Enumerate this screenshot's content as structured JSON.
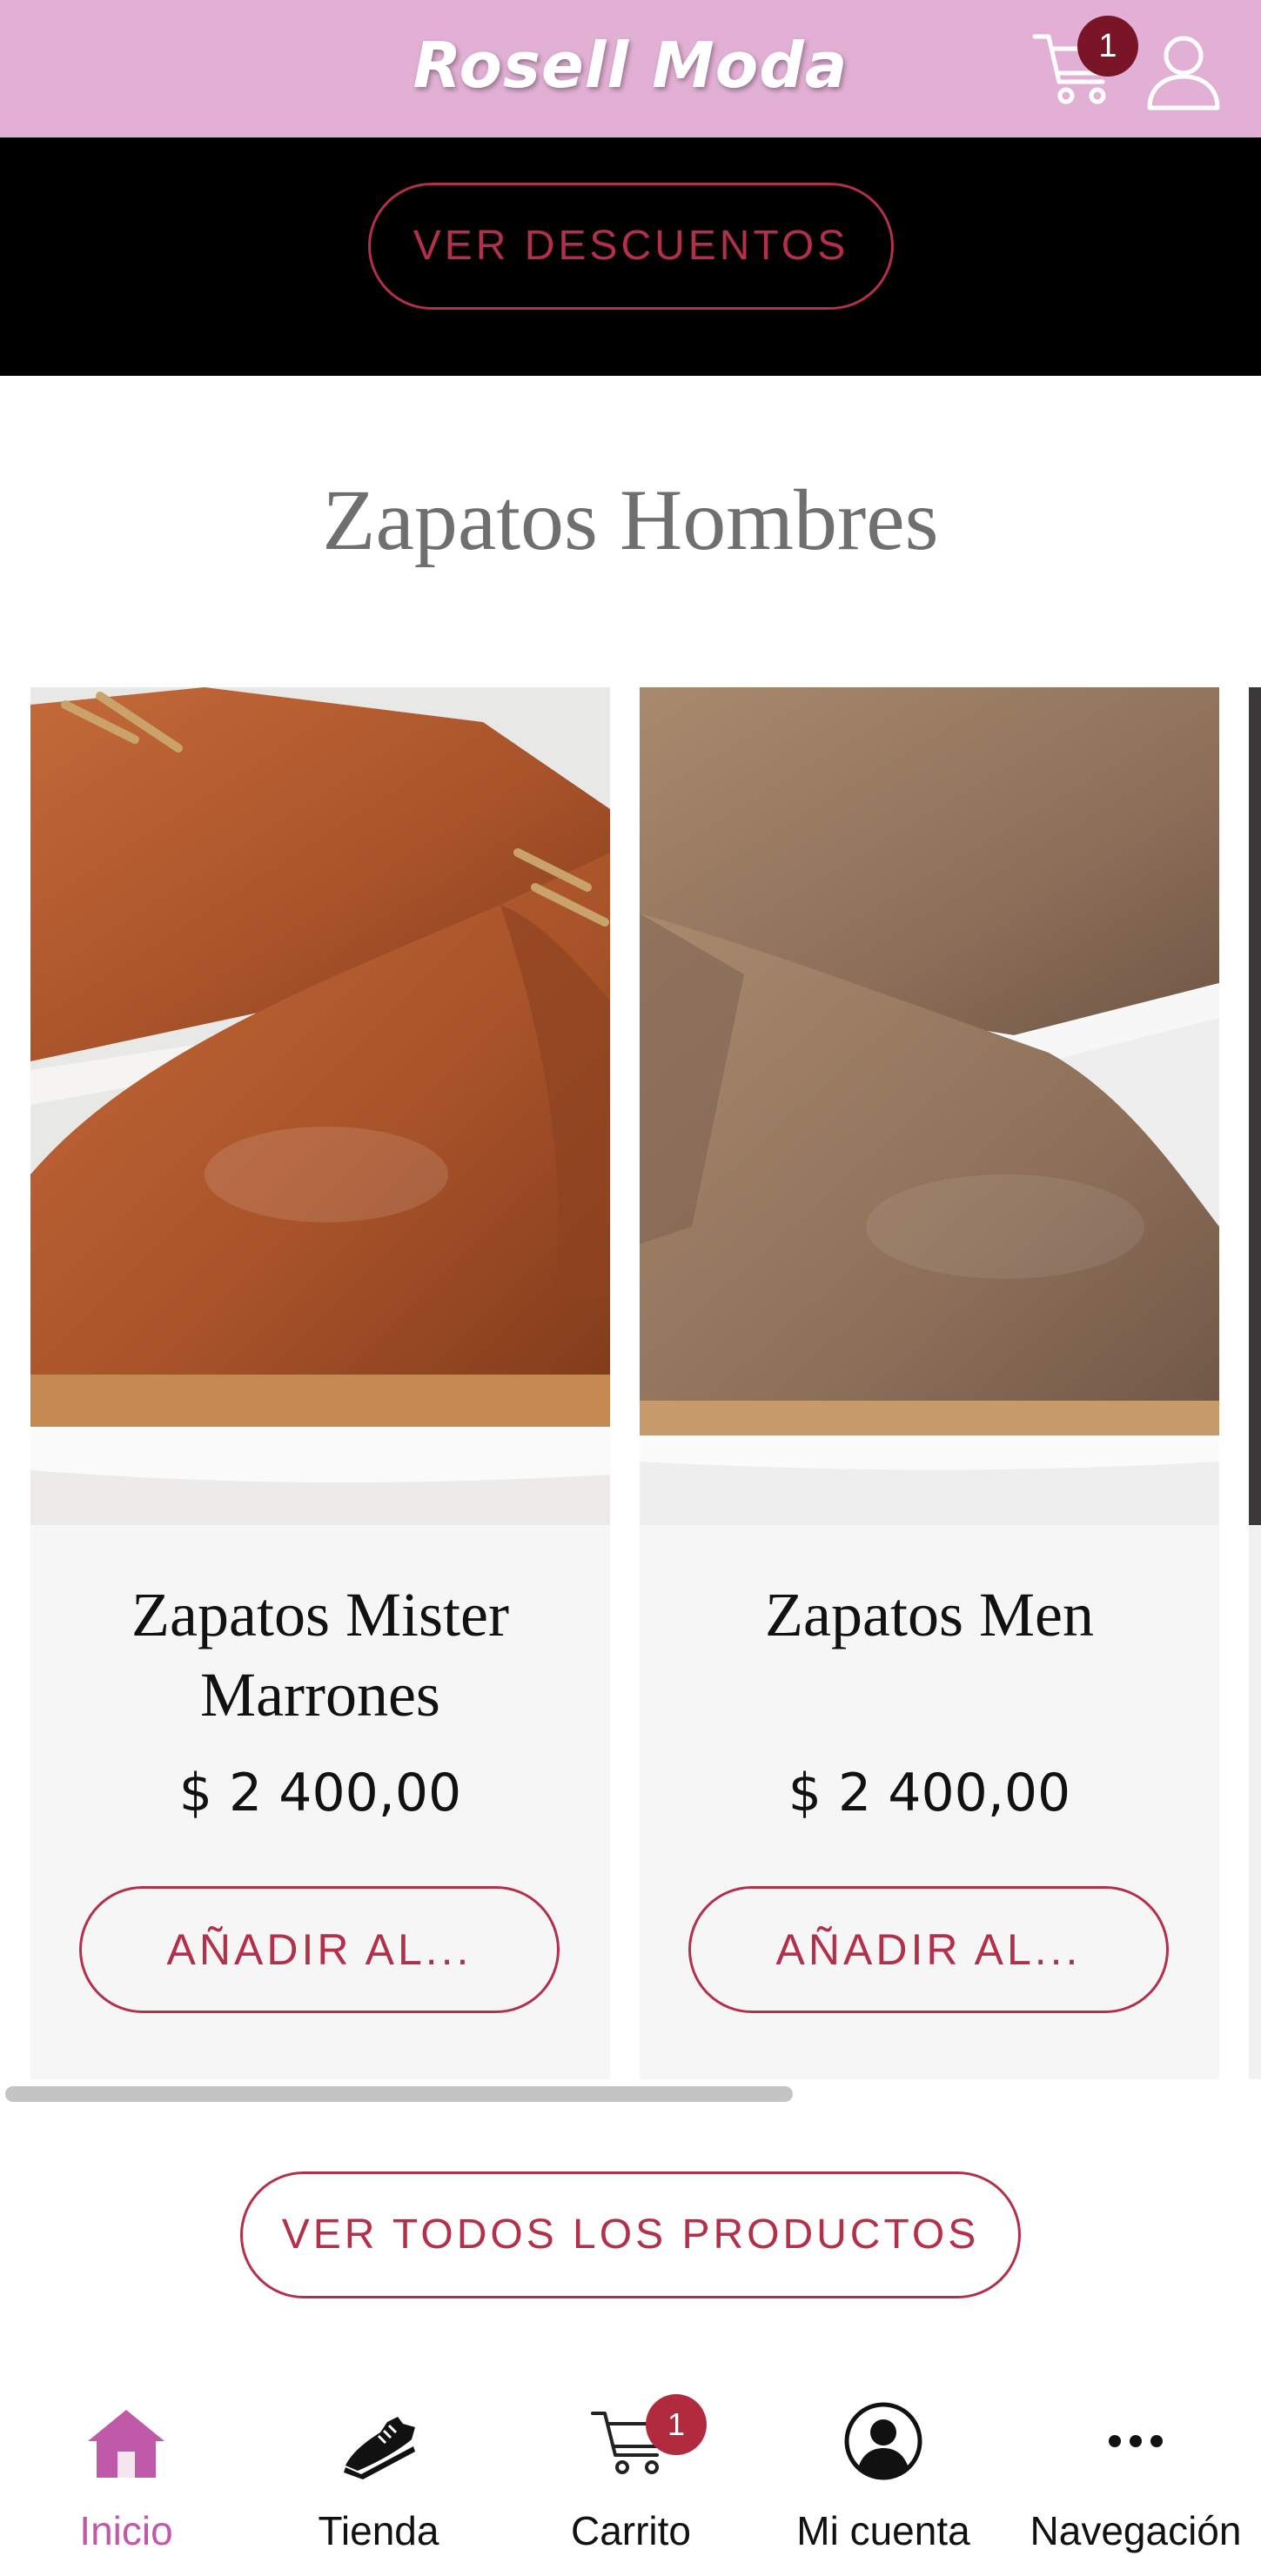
{
  "header": {
    "brand": "Rosell Moda",
    "cart_count": "1",
    "icons": {
      "cart": "cart-icon",
      "user": "user-icon"
    },
    "background": "#e2b0d4"
  },
  "promo": {
    "button_label": "VER DESCUENTOS"
  },
  "section": {
    "title": "Zapatos Hombres"
  },
  "products": [
    {
      "title": "Zapatos Mister Marrones",
      "price": "$ 2 400,00",
      "button_label": "AÑADIR AL..."
    },
    {
      "title": "Zapatos Men",
      "price": "$ 2 400,00",
      "button_label": "AÑADIR AL..."
    }
  ],
  "actions": {
    "view_all_label": "VER TODOS LOS PRODUCTOS"
  },
  "bottom_nav": {
    "items": [
      {
        "label": "Inicio",
        "icon": "home-icon",
        "active": true
      },
      {
        "label": "Tienda",
        "icon": "sneaker-icon"
      },
      {
        "label": "Carrito",
        "icon": "cart-icon",
        "badge": "1"
      },
      {
        "label": "Mi cuenta",
        "icon": "account-icon"
      },
      {
        "label": "Navegación",
        "icon": "more-icon"
      }
    ]
  },
  "colors": {
    "accent": "#b2304a",
    "active_nav": "#c05aa8",
    "badge": "#b22a3e"
  }
}
